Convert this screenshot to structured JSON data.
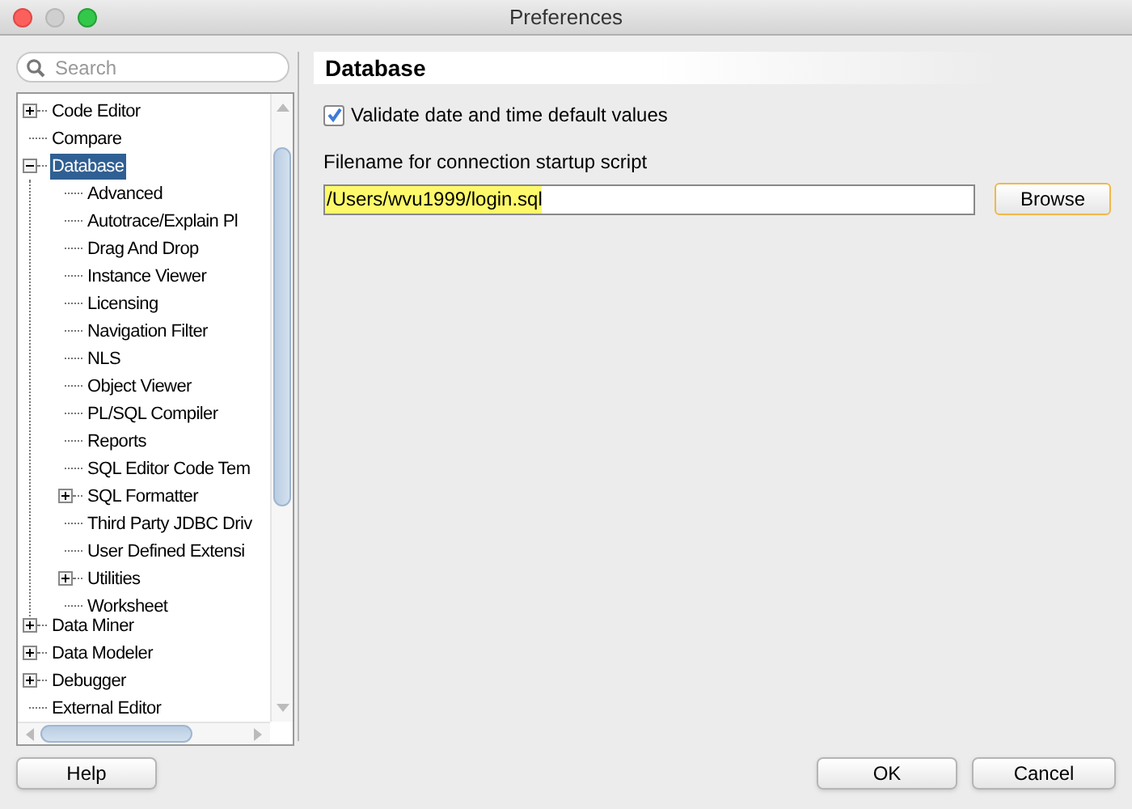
{
  "window": {
    "title": "Preferences"
  },
  "search": {
    "placeholder": "Search"
  },
  "tree": [
    {
      "label": "Code Editor",
      "kind": "node",
      "expanded": false,
      "selected": false
    },
    {
      "label": "Compare",
      "kind": "leaf",
      "selected": false
    },
    {
      "label": "Database",
      "kind": "node",
      "expanded": true,
      "selected": true,
      "children": [
        {
          "label": "Advanced",
          "kind": "leaf",
          "selected": false
        },
        {
          "label": "Autotrace/Explain Pl",
          "kind": "leaf",
          "selected": false
        },
        {
          "label": "Drag And Drop",
          "kind": "leaf",
          "selected": false
        },
        {
          "label": "Instance Viewer",
          "kind": "leaf",
          "selected": false
        },
        {
          "label": "Licensing",
          "kind": "leaf",
          "selected": false
        },
        {
          "label": "Navigation Filter",
          "kind": "leaf",
          "selected": false
        },
        {
          "label": "NLS",
          "kind": "leaf",
          "selected": false
        },
        {
          "label": "Object Viewer",
          "kind": "leaf",
          "selected": false
        },
        {
          "label": "PL/SQL Compiler",
          "kind": "leaf",
          "selected": false
        },
        {
          "label": "Reports",
          "kind": "leaf",
          "selected": false
        },
        {
          "label": "SQL Editor Code Tem",
          "kind": "leaf",
          "selected": false
        },
        {
          "label": "SQL Formatter",
          "kind": "node",
          "expanded": false,
          "selected": false
        },
        {
          "label": "Third Party JDBC Driv",
          "kind": "leaf",
          "selected": false
        },
        {
          "label": "User Defined Extensi",
          "kind": "leaf",
          "selected": false
        },
        {
          "label": "Utilities",
          "kind": "node",
          "expanded": false,
          "selected": false
        },
        {
          "label": "Worksheet",
          "kind": "leaf",
          "selected": false
        }
      ]
    },
    {
      "label": "Data Miner",
      "kind": "node",
      "expanded": false,
      "selected": false
    },
    {
      "label": "Data Modeler",
      "kind": "node",
      "expanded": false,
      "selected": false
    },
    {
      "label": "Debugger",
      "kind": "node",
      "expanded": false,
      "selected": false
    },
    {
      "label": "External Editor",
      "kind": "leaf",
      "selected": false
    }
  ],
  "panel": {
    "heading": "Database",
    "checkbox": {
      "label": "Validate date and time default values",
      "checked": true
    },
    "field_label": "Filename for connection startup script",
    "field": {
      "value": "/Users/wvu1999/login.sql"
    },
    "browse": {
      "label": "Browse"
    }
  },
  "buttons": [
    {
      "label": "Help",
      "kind": "help"
    },
    {
      "label": "OK",
      "kind": "ok"
    },
    {
      "label": "Cancel",
      "kind": "cancel"
    }
  ]
}
